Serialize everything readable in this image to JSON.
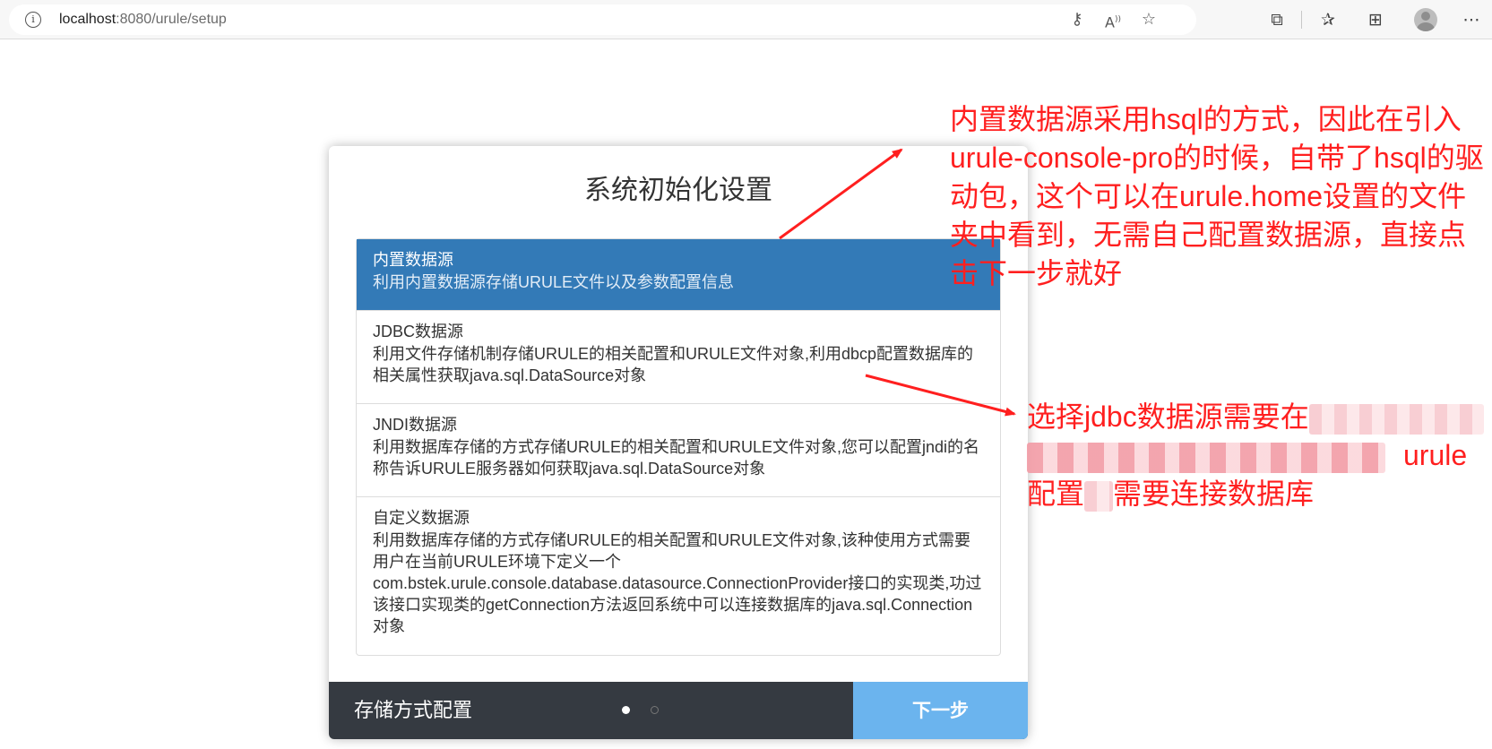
{
  "browser": {
    "url_host": "localhost",
    "url_path": ":8080/urule/setup",
    "icons": [
      "info-icon",
      "key-icon",
      "read-aloud-icon",
      "favorite-add-icon",
      "extensions-icon",
      "favorites-icon",
      "collections-icon",
      "profile-icon",
      "more-icon"
    ]
  },
  "dialog": {
    "title": "系统初始化设置",
    "options": [
      {
        "name": "内置数据源",
        "desc": "利用内置数据源存储URULE文件以及参数配置信息",
        "selected": true
      },
      {
        "name": "JDBC数据源",
        "desc": "利用文件存储机制存储URULE的相关配置和URULE文件对象,利用dbcp配置数据库的相关属性获取java.sql.DataSource对象",
        "selected": false
      },
      {
        "name": "JNDI数据源",
        "desc": "利用数据库存储的方式存储URULE的相关配置和URULE文件对象,您可以配置jndi的名称告诉URULE服务器如何获取java.sql.DataSource对象",
        "selected": false
      },
      {
        "name": "自定义数据源",
        "desc": "利用数据库存储的方式存储URULE的相关配置和URULE文件对象,该种使用方式需要用户在当前URULE环境下定义一个com.bstek.urule.console.database.datasource.ConnectionProvider接口的实现类,功过该接口实现类的getConnection方法返回系统中可以连接数据库的java.sql.Connection对象",
        "selected": false
      }
    ],
    "footer": {
      "label": "存储方式配置",
      "step_current": 1,
      "step_total": 2,
      "next_label": "下一步"
    }
  },
  "annotations": {
    "note_builtin": "内置数据源采用hsql的方式，因此在引入urule-console-pro的时候，自带了hsql的驱动包，这个可以在urule.home设置的文件夹中看到，无需自己配置数据源，直接点击下一步就好",
    "note_jdbc_line1": "选择jdbc数据源需要在",
    "note_jdbc_line2": "urule",
    "note_jdbc_line3a": "配置",
    "note_jdbc_line3b": "需要连接数据库",
    "color": "#ff1f1f"
  },
  "colors": {
    "selected_bg": "#337ab7",
    "footer_bg": "#353a41",
    "next_bg": "#6bb4ee"
  }
}
